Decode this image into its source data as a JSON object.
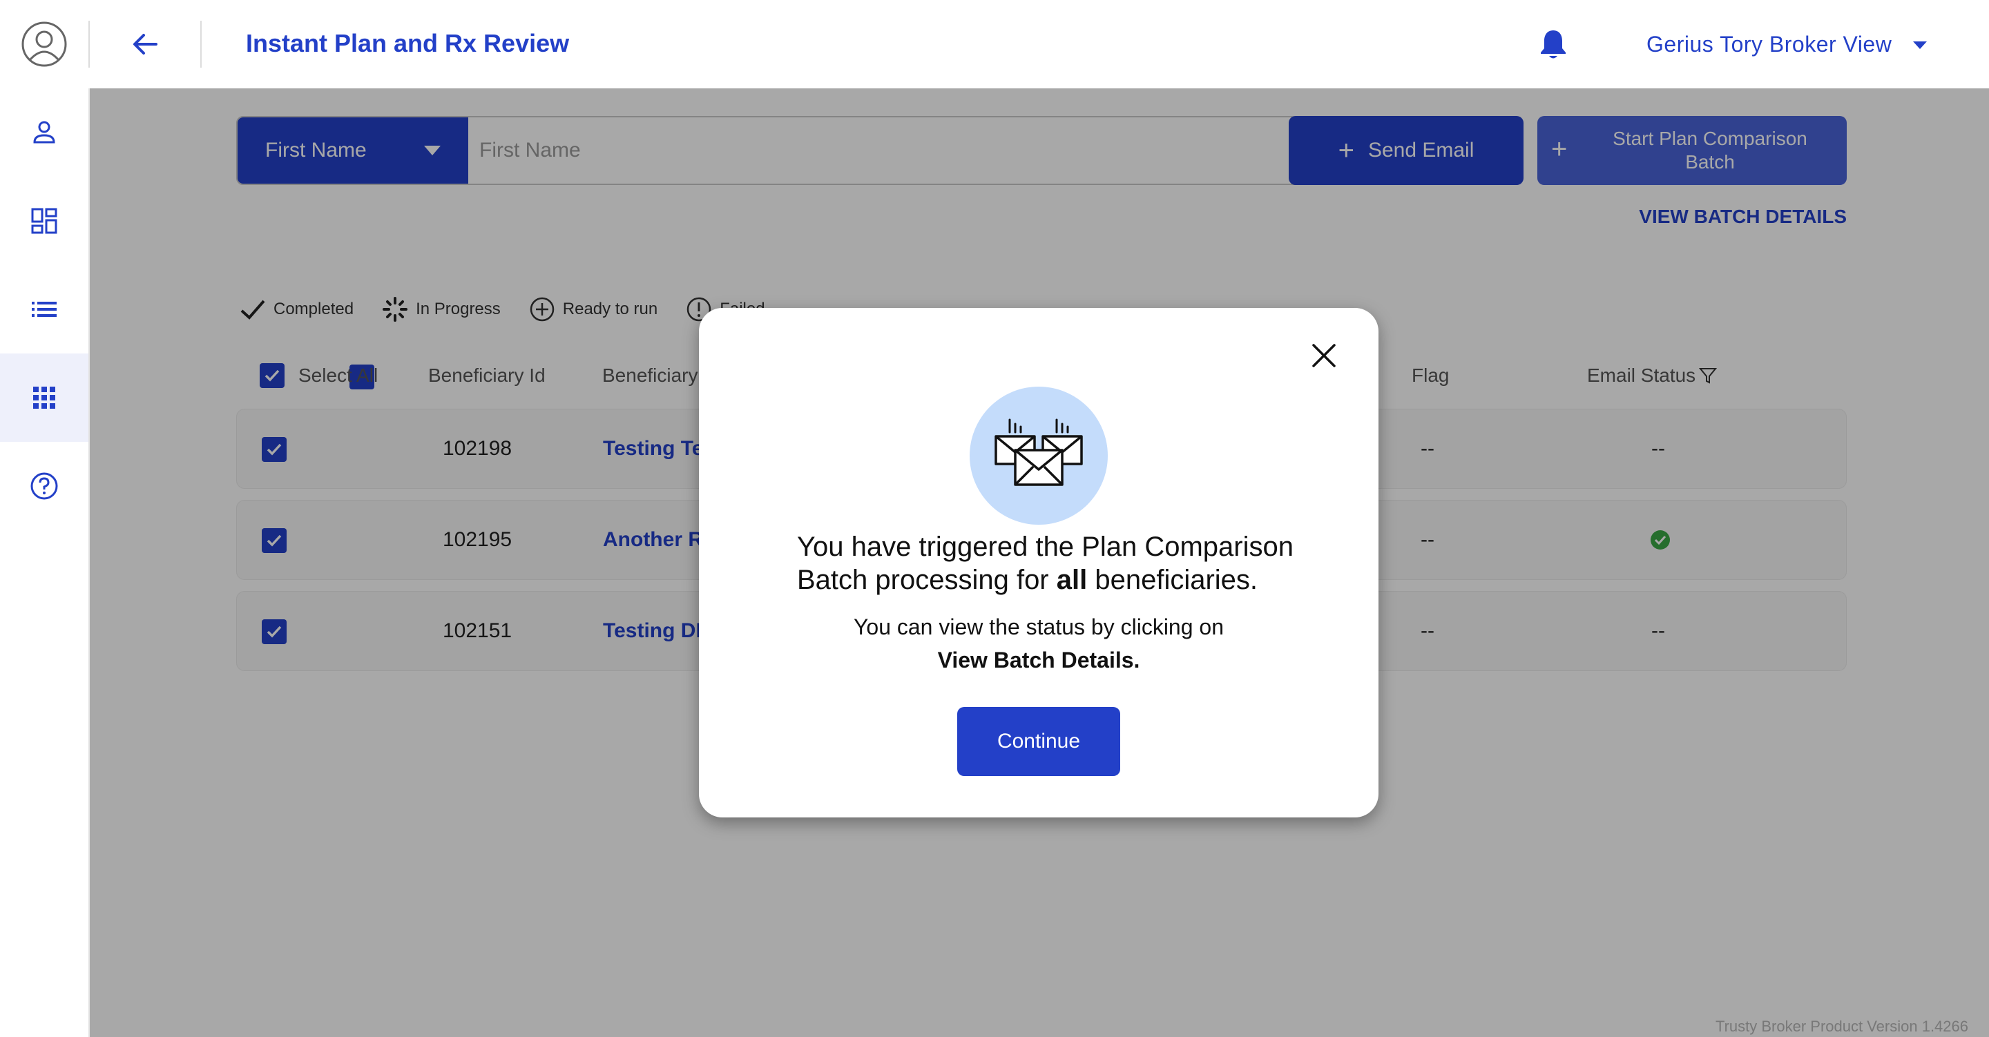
{
  "header": {
    "title": "Instant Plan and Rx Review",
    "user_name": "Gerius Tory Broker View"
  },
  "search": {
    "field_select": "First Name",
    "placeholder": "First Name"
  },
  "actions": {
    "send_email": "Send Email",
    "start_batch": "Start Plan Comparison Batch",
    "view_batch_details": "VIEW BATCH DETAILS"
  },
  "legend": {
    "completed": "Completed",
    "in_progress": "In Progress",
    "ready": "Ready to run",
    "failed": "Failed"
  },
  "table": {
    "headers": {
      "select_all": "Select All",
      "beneficiary_id": "Beneficiary Id",
      "beneficiary": "Beneficiary",
      "flag": "Flag",
      "email_status": "Email Status"
    },
    "rows": [
      {
        "id": "102198",
        "name": "Testing Te",
        "flag": "--",
        "email_status": "--",
        "email_ok": false
      },
      {
        "id": "102195",
        "name": "Another R",
        "flag": "--",
        "email_status": "",
        "email_ok": true
      },
      {
        "id": "102151",
        "name": "Testing DE",
        "flag": "--",
        "email_status": "--",
        "email_ok": false
      }
    ]
  },
  "modal": {
    "message_part1": "You have triggered the Plan Comparison Batch processing for ",
    "message_bold": "all",
    "message_part2": " beneficiaries.",
    "sub_line1": "You can view the status by clicking on",
    "sub_line2": "View Batch Details.",
    "continue": "Continue"
  },
  "footer": {
    "version": "Trusty Broker Product Version 1.4266"
  },
  "colors": {
    "primary": "#2340c8",
    "overlay": "rgba(0,0,0,0.34)",
    "success": "#3aa845"
  }
}
